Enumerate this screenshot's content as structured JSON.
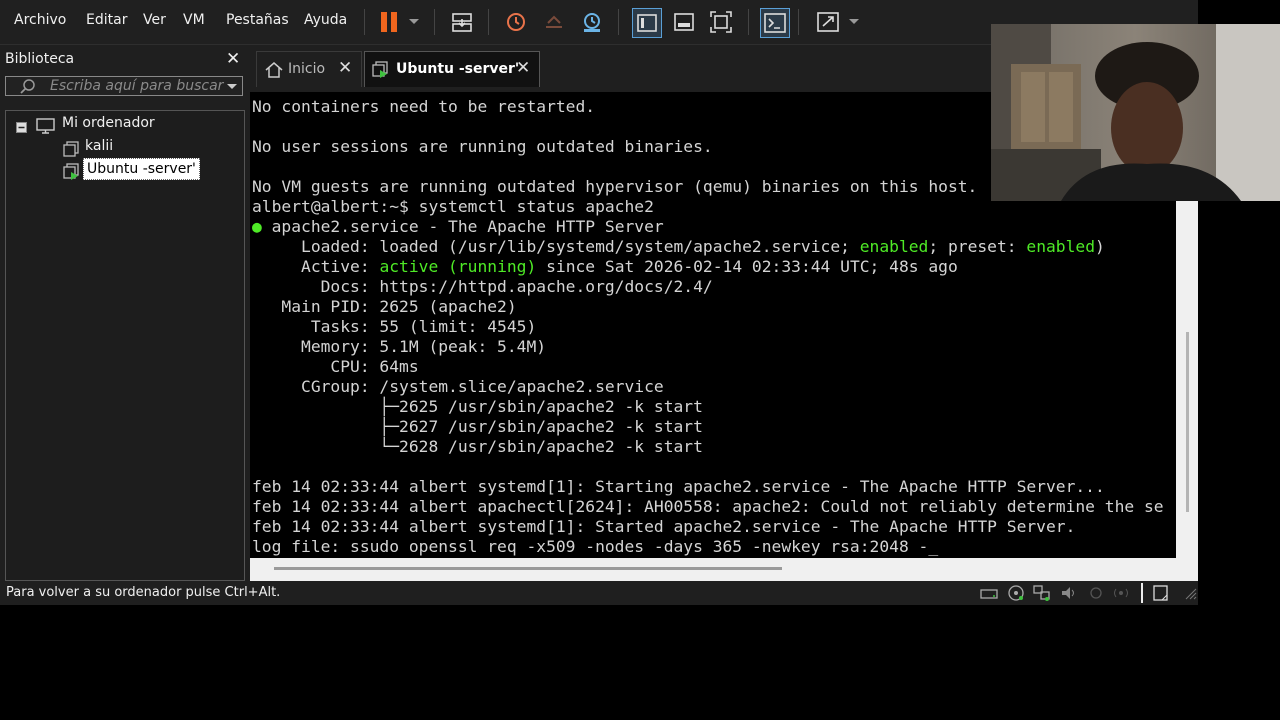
{
  "menubar": {
    "items": [
      "Archivo",
      "Editar",
      "Ver",
      "VM",
      "Pestañas",
      "Ayuda"
    ]
  },
  "sidebar": {
    "title": "Biblioteca",
    "search_placeholder": "Escriba aquí para buscar",
    "tree": {
      "root": "Mi ordenador",
      "vms": [
        "kalii",
        "Ubuntu -server'"
      ]
    }
  },
  "tabs": [
    {
      "label": "Inicio",
      "active": false
    },
    {
      "label": "Ubuntu -server'",
      "active": true
    }
  ],
  "terminal": {
    "lines": [
      "No containers need to be restarted.",
      "",
      "No user sessions are running outdated binaries.",
      "",
      "No VM guests are running outdated hypervisor (qemu) binaries on this host.",
      "albert@albert:~$ systemctl status apache2",
      "● apache2.service - The Apache HTTP Server",
      "     Loaded: loaded (/usr/lib/systemd/system/apache2.service; enabled; preset: enabled)",
      "     Active: active (running) since Sat 2026-02-14 02:33:44 UTC; 48s ago",
      "       Docs: https://httpd.apache.org/docs/2.4/",
      "   Main PID: 2625 (apache2)",
      "      Tasks: 55 (limit: 4545)",
      "     Memory: 5.1M (peak: 5.4M)",
      "        CPU: 64ms",
      "     CGroup: /system.slice/apache2.service",
      "             ├─2625 /usr/sbin/apache2 -k start",
      "             ├─2627 /usr/sbin/apache2 -k start",
      "             └─2628 /usr/sbin/apache2 -k start",
      "",
      "feb 14 02:33:44 albert systemd[1]: Starting apache2.service - The Apache HTTP Server...",
      "feb 14 02:33:44 albert apachectl[2624]: AH00558: apache2: Could not reliably determine the se",
      "feb 14 02:33:44 albert systemd[1]: Started apache2.service - The Apache HTTP Server.",
      "log file: ssudo openssl req -x509 -nodes -days 365 -newkey rsa:2048 -_"
    ]
  },
  "statusbar": {
    "text": "Para volver a su ordenador pulse Ctrl+Alt."
  },
  "colors": {
    "terminal_green": "#4eea26",
    "pause_orange": "#f0661e",
    "accent_blue": "#5a9fd6"
  }
}
